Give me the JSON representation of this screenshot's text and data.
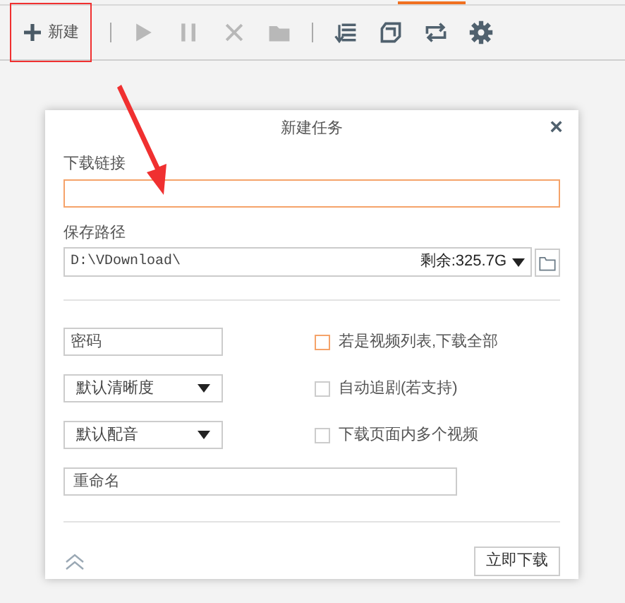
{
  "toolbar": {
    "new_button": {
      "label": "新建",
      "annotated": true
    },
    "tools": [
      {
        "kind": "play",
        "disabled": true
      },
      {
        "kind": "pause",
        "disabled": true
      },
      {
        "kind": "delete",
        "disabled": true
      },
      {
        "kind": "folder",
        "disabled": true
      },
      {
        "kind": "separator"
      },
      {
        "kind": "list",
        "disabled": false
      },
      {
        "kind": "window",
        "disabled": false
      },
      {
        "kind": "repeat",
        "disabled": false
      },
      {
        "kind": "settings",
        "disabled": false
      }
    ]
  },
  "dialog": {
    "title": "新建任务",
    "close": "×",
    "link": {
      "label": "下载链接",
      "focused": true
    },
    "save_path": {
      "label": "保存路径",
      "value": "D:\\VDownload\\",
      "free_space": "剩余:325.7G"
    },
    "password": {
      "placeholder": "密码"
    },
    "quality": {
      "value": "默认清晰度"
    },
    "audio": {
      "value": "默认配音"
    },
    "rename": {
      "placeholder": "重命名"
    },
    "options": [
      {
        "label": "若是视频列表,下载全部",
        "checked": false,
        "focused": true
      },
      {
        "label": "自动追剧(若支持)",
        "checked": false,
        "focused": false
      },
      {
        "label": "下载页面内多个视频",
        "checked": false,
        "focused": false
      }
    ],
    "download_button": "立即下载"
  }
}
